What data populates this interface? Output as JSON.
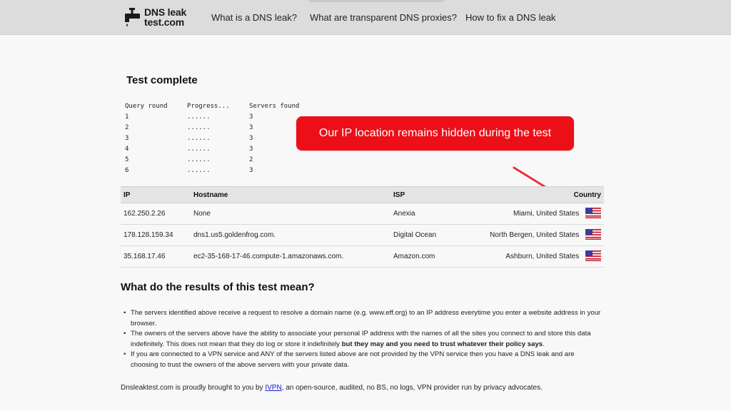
{
  "header": {
    "logo_line1": "DNS leak",
    "logo_line2": "test.com",
    "nav": [
      {
        "label": "What is a DNS leak?"
      },
      {
        "label": "What are transparent DNS proxies?"
      },
      {
        "label": "How to fix a DNS leak"
      }
    ]
  },
  "test": {
    "title": "Test complete",
    "columns": [
      "Query round",
      "Progress...",
      "Servers found"
    ],
    "rounds": [
      {
        "round": "1",
        "progress": "......",
        "servers": "3"
      },
      {
        "round": "2",
        "progress": "......",
        "servers": "3"
      },
      {
        "round": "3",
        "progress": "......",
        "servers": "3"
      },
      {
        "round": "4",
        "progress": "......",
        "servers": "3"
      },
      {
        "round": "5",
        "progress": "......",
        "servers": "2"
      },
      {
        "round": "6",
        "progress": "......",
        "servers": "3"
      }
    ]
  },
  "callout": {
    "text": "Our IP location remains hidden during the test",
    "color": "#ec0f17"
  },
  "results": {
    "headers": {
      "ip": "IP",
      "hostname": "Hostname",
      "isp": "ISP",
      "country": "Country"
    },
    "rows": [
      {
        "ip": "162.250.2.26",
        "hostname": "None",
        "isp": "Anexia",
        "country": "Miami, United States",
        "flag": "us-flag-icon"
      },
      {
        "ip": "178.128.159.34",
        "hostname": "dns1.us5.goldenfrog.com.",
        "isp": "Digital Ocean",
        "country": "North Bergen, United States",
        "flag": "us-flag-icon"
      },
      {
        "ip": "35.168.17.46",
        "hostname": "ec2-35-168-17-46.compute-1.amazonaws.com.",
        "isp": "Amazon.com",
        "country": "Ashburn, United States",
        "flag": "us-flag-icon"
      }
    ]
  },
  "meaning": {
    "title": "What do the results of this test mean?",
    "points": [
      {
        "text": "The servers identified above receive a request to resolve a domain name (e.g. www.eff.org) to an IP address everytime you enter a website address in your browser."
      },
      {
        "text": "The owners of the servers above have the ability to associate your personal IP address with the names of all the sites you connect to and store this data indefinitely. This does not mean that they do log or store it indefinitely ",
        "bold": "but they may and you need to trust whatever their policy says",
        "after": "."
      },
      {
        "text": "If you are connected to a VPN service and ANY of the servers listed above are not provided by the VPN service then you have a DNS leak and are choosing to trust the owners of the above servers with your private data."
      }
    ]
  },
  "footer": {
    "before": "Dnsleaktest.com is proudly brought to you by ",
    "link": "IVPN",
    "after": ", an open-source, audited, no BS, no logs, VPN provider run by privacy advocates."
  }
}
